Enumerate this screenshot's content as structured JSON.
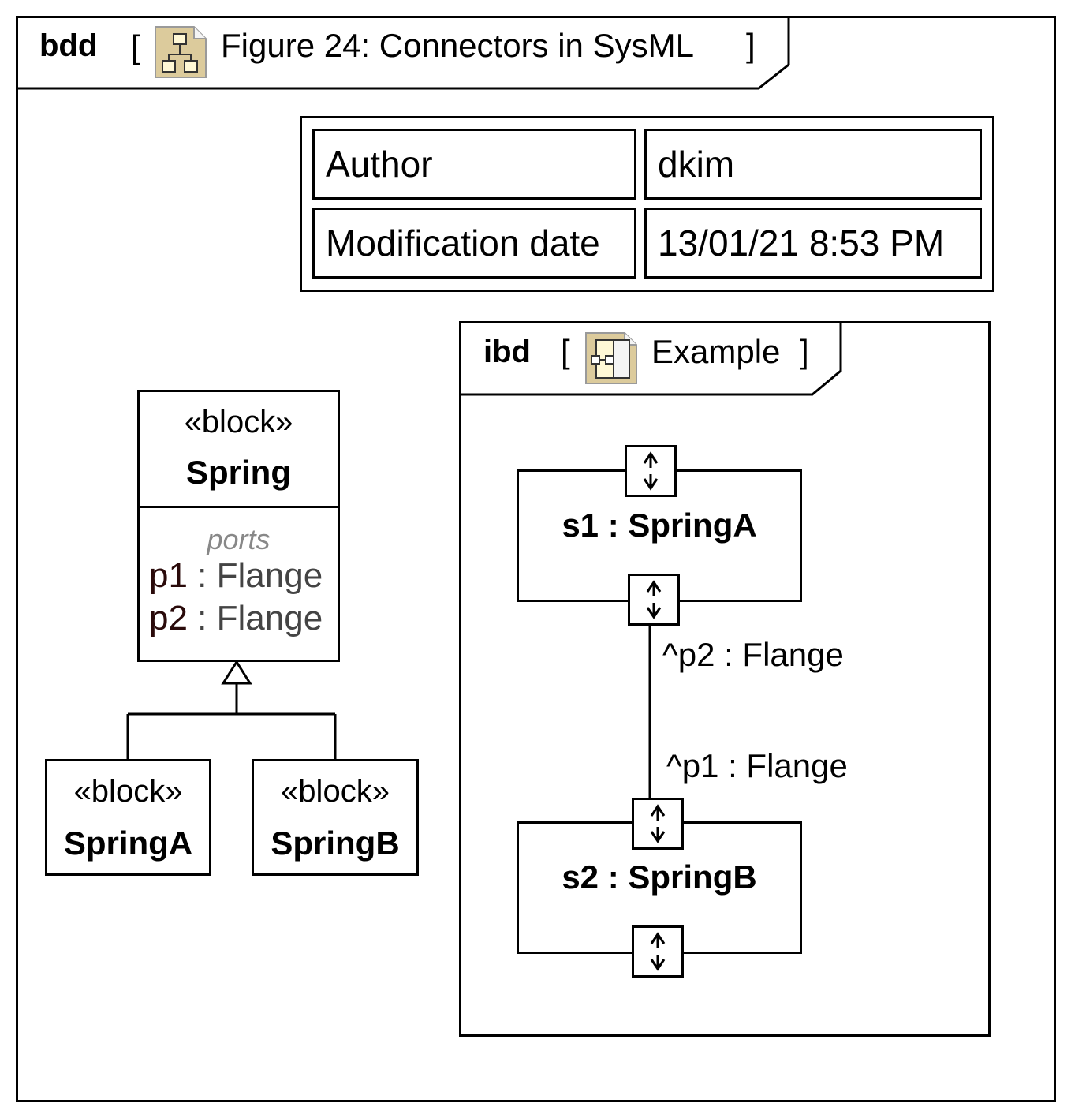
{
  "bdd_frame": {
    "kind": "bdd",
    "open_bracket": "[",
    "title": "Figure 24: Connectors in SysML",
    "close_bracket": "]",
    "icon": "block-definition-diagram-icon"
  },
  "info_table": {
    "rows": [
      {
        "key": "Author",
        "value": "dkim"
      },
      {
        "key": "Modification date",
        "value": "13/01/21 8:53 PM"
      }
    ]
  },
  "blocks": {
    "spring": {
      "stereotype": "«block»",
      "name": "Spring",
      "compartment_label": "ports",
      "ports": [
        {
          "name": "p1",
          "sep": " : ",
          "type": "Flange"
        },
        {
          "name": "p2",
          "sep": " : ",
          "type": "Flange"
        }
      ]
    },
    "springA": {
      "stereotype": "«block»",
      "name": "SpringA"
    },
    "springB": {
      "stereotype": "«block»",
      "name": "SpringB"
    }
  },
  "ibd_frame": {
    "kind": "ibd",
    "open_bracket": "[",
    "title": "Example",
    "close_bracket": "]",
    "icon": "internal-block-diagram-icon",
    "parts": [
      {
        "label": "s1 : SpringA"
      },
      {
        "label": "s2 : SpringB"
      }
    ],
    "connector": {
      "end1_label": "^p2 : Flange",
      "end2_label": "^p1 : Flange"
    }
  },
  "colors": {
    "line": "#000000",
    "port_type_text": "#444444",
    "compartment_label": "#888888",
    "icon_fill": "#dccb9c",
    "icon_border": "#9a9a9a"
  }
}
